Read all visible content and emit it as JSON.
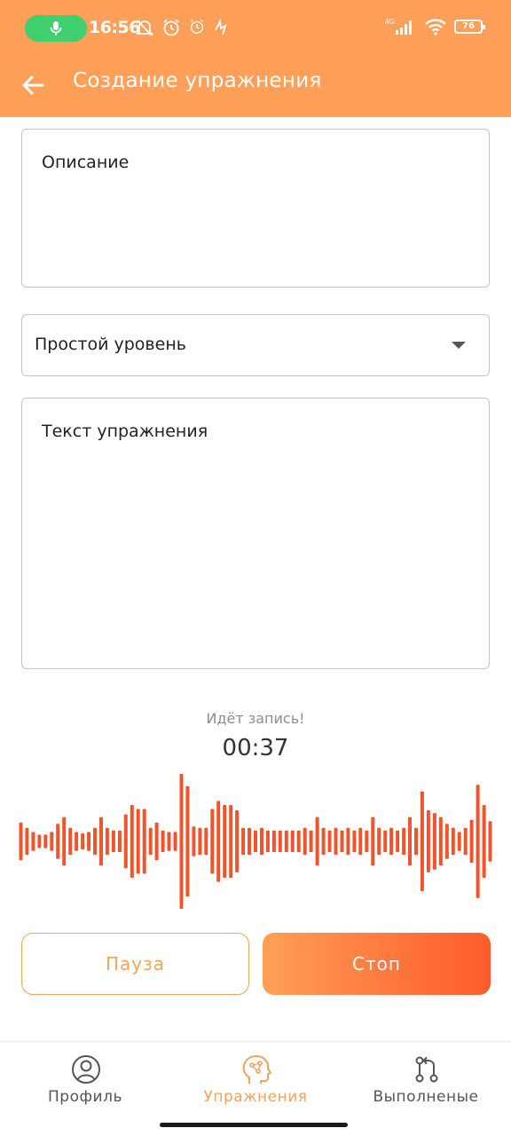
{
  "status_bar": {
    "time": "16:56",
    "battery_level": "76",
    "network_label": "4G",
    "icons_left": [
      "mic-icon",
      "bell-off-icon",
      "alarm-icon",
      "alarm-small-icon",
      "activity-icon"
    ],
    "icons_right": [
      "signal-icon",
      "wifi-icon",
      "battery-icon"
    ]
  },
  "app_bar": {
    "title": "Создание упражнения",
    "back_icon": "arrow-left-icon"
  },
  "form": {
    "description_placeholder": "Описание",
    "level_value": "Простой уровень",
    "text_placeholder": "Текст упражнения"
  },
  "recording": {
    "status": "Идёт запись!",
    "elapsed": "00:37",
    "waveform_color": "#f0542c",
    "waveform_levels": [
      0.28,
      0.2,
      0.14,
      0.1,
      0.1,
      0.14,
      0.26,
      0.36,
      0.2,
      0.14,
      0.12,
      0.14,
      0.2,
      0.36,
      0.2,
      0.16,
      0.16,
      0.4,
      0.54,
      0.48,
      0.48,
      0.2,
      0.28,
      0.16,
      0.14,
      0.14,
      1.0,
      0.82,
      0.22,
      0.2,
      0.2,
      0.48,
      0.6,
      0.54,
      0.54,
      0.46,
      0.2,
      0.2,
      0.16,
      0.2,
      0.16,
      0.16,
      0.16,
      0.16,
      0.16,
      0.16,
      0.2,
      0.16,
      0.36,
      0.2,
      0.16,
      0.2,
      0.16,
      0.2,
      0.16,
      0.2,
      0.16,
      0.36,
      0.2,
      0.16,
      0.2,
      0.16,
      0.2,
      0.36,
      0.2,
      0.74,
      0.46,
      0.42,
      0.36,
      0.26,
      0.2,
      0.14,
      0.2,
      0.32,
      0.84,
      0.54,
      0.3
    ]
  },
  "buttons": {
    "pause": "Пауза",
    "stop": "Стоп"
  },
  "colors": {
    "accent": "#ff9f58",
    "accent_dark": "#ff5a2b",
    "nav_active": "#f3a35e"
  },
  "bottom_nav": {
    "items": [
      {
        "label": "Профиль",
        "icon": "profile-icon",
        "active": false
      },
      {
        "label": "Упражнения",
        "icon": "exercises-icon",
        "active": true
      },
      {
        "label": "Выполненые",
        "icon": "completed-icon",
        "active": false
      }
    ]
  }
}
